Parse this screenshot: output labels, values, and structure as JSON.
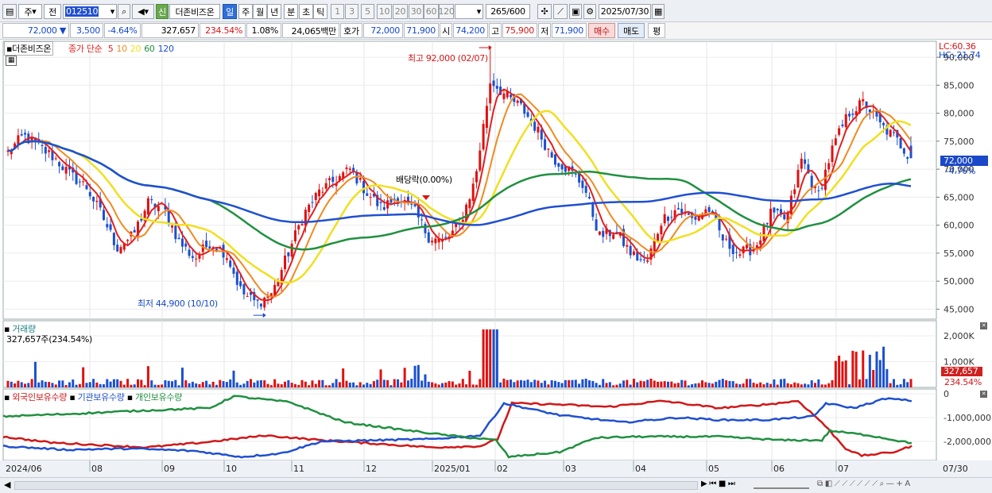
{
  "toolbar": {
    "period_stock": "주",
    "period_prev": "전",
    "code": "012510",
    "new_badge": "신",
    "stock_name": "더존비즈온",
    "periods": [
      "일",
      "주",
      "월",
      "년",
      "분",
      "초",
      "틱"
    ],
    "active_period": "일",
    "intervals": [
      "1",
      "3",
      "5",
      "10",
      "20",
      "30",
      "60",
      "120"
    ],
    "count": "265",
    "count_max": "/600",
    "date": "2025/07/30"
  },
  "quote": {
    "price": "72,000",
    "change_arrow": "▼",
    "change": "3,500",
    "change_pct": "-4.64%",
    "volume": "327,657",
    "volume_ratio": "234.54%",
    "turnover_rate": "1.08%",
    "trade_value": "24,065백만",
    "ask_label": "호가",
    "ask": "72,000",
    "bid": "71,900",
    "open_label": "시",
    "open": "74,200",
    "high_label": "고",
    "high": "75,900",
    "low_label": "저",
    "low": "71,900",
    "buy_button": "매수",
    "sell_button": "매도",
    "eval_button": "평"
  },
  "price_panel": {
    "title": "더존비즈온",
    "ma_label": "종가 단순",
    "ma_periods": [
      "5",
      "10",
      "20",
      "60",
      "120"
    ],
    "ma_colors": [
      "#e02020",
      "#f08a20",
      "#f0e020",
      "#209040",
      "#2050d0"
    ],
    "lc": "LC:60.36",
    "hc": "HC:-21.74",
    "high_note": "최고 92,000 (02/07)",
    "low_note": "최저 44,900 (10/10)",
    "dividend_note": "배당락(0.00%)",
    "current_price_tag": "72,000",
    "current_change_tag": "-4.76%",
    "y_ticks": [
      "90,000",
      "85,000",
      "80,000",
      "75,000",
      "70,000",
      "65,000",
      "60,000",
      "55,000",
      "50,000",
      "45,000"
    ]
  },
  "volume_panel": {
    "title": "거래량",
    "summary": "327,657주(234.54%)",
    "y_ticks": [
      "2,000K",
      "1,000K"
    ],
    "tag_value": "327,657",
    "tag_pct": "234.54%"
  },
  "holdings_panel": {
    "legend": [
      "외국인보유수량",
      "기관보유수량",
      "개인보유수량"
    ],
    "legend_colors": [
      "#d01818",
      "#2050d0",
      "#209040"
    ],
    "y_ticks": [
      "0",
      "-1,000,000",
      "-2,000,000"
    ]
  },
  "x_axis": [
    "2024/06",
    "08",
    "09",
    "10",
    "11",
    "12",
    "2025/01",
    "02",
    "03",
    "04",
    "05",
    "06",
    "07"
  ],
  "x_axis_right": "07/30",
  "chart_data": {
    "type": "candlestick",
    "title": "더존비즈온",
    "x_range": [
      "2024/06",
      "2025/07/30"
    ],
    "y_range": [
      43500,
      92000
    ],
    "highest": {
      "value": 92000,
      "date": "02/07"
    },
    "lowest": {
      "value": 44900,
      "date": "10/10"
    },
    "last": {
      "date": "2025/07/30",
      "open": 74200,
      "high": 75900,
      "low": 71900,
      "close": 72000,
      "volume": 327657
    },
    "close_path": [
      [
        "2024/06",
        73000
      ],
      [
        "2024/06",
        76000
      ],
      [
        "2024/07",
        74000
      ],
      [
        "2024/07",
        72000
      ],
      [
        "2024/07",
        69000
      ],
      [
        "2024/08",
        67000
      ],
      [
        "2024/08",
        62000
      ],
      [
        "2024/08",
        56000
      ],
      [
        "2024/08",
        58000
      ],
      [
        "2024/08",
        64000
      ],
      [
        "2024/09",
        63000
      ],
      [
        "2024/09",
        57000
      ],
      [
        "2024/09",
        54000
      ],
      [
        "2024/09",
        57000
      ],
      [
        "2024/10",
        55000
      ],
      [
        "2024/10",
        48000
      ],
      [
        "2024/10",
        46000
      ],
      [
        "2024/10",
        48000
      ],
      [
        "2024/11",
        55000
      ],
      [
        "2024/11",
        62000
      ],
      [
        "2024/11",
        66000
      ],
      [
        "2024/11",
        68000
      ],
      [
        "2024/12",
        70000
      ],
      [
        "2024/12",
        66000
      ],
      [
        "2024/12",
        63000
      ],
      [
        "2024/12",
        65000
      ],
      [
        "2025/01",
        63000
      ],
      [
        "2025/01",
        58000
      ],
      [
        "2025/01",
        57000
      ],
      [
        "2025/01",
        60000
      ],
      [
        "2025/01",
        68000
      ],
      [
        "2025/02",
        86000
      ],
      [
        "2025/02",
        83000
      ],
      [
        "2025/02",
        81000
      ],
      [
        "2025/03",
        77000
      ],
      [
        "2025/03",
        72000
      ],
      [
        "2025/03",
        70000
      ],
      [
        "2025/03",
        67000
      ],
      [
        "2025/04",
        58000
      ],
      [
        "2025/04",
        59000
      ],
      [
        "2025/04",
        55000
      ],
      [
        "2025/04",
        53000
      ],
      [
        "2025/04",
        61000
      ],
      [
        "2025/05",
        63000
      ],
      [
        "2025/05",
        61000
      ],
      [
        "2025/05",
        63000
      ],
      [
        "2025/05",
        57000
      ],
      [
        "2025/05",
        55000
      ],
      [
        "2025/06",
        56000
      ],
      [
        "2025/06",
        62000
      ],
      [
        "2025/06",
        61000
      ],
      [
        "2025/06",
        72000
      ],
      [
        "2025/07",
        65000
      ],
      [
        "2025/07",
        74000
      ],
      [
        "2025/07",
        80000
      ],
      [
        "2025/07",
        82000
      ],
      [
        "2025/07",
        78000
      ],
      [
        "2025/07",
        75500
      ],
      [
        "2025/07/30",
        72000
      ]
    ],
    "volume_spikes_k": [
      [
        "2024/10",
        1100
      ],
      [
        "2024/10",
        1200
      ],
      [
        "2025/01",
        1700
      ],
      [
        "2025/02",
        2250
      ],
      [
        "2025/03",
        1100
      ],
      [
        "2025/04",
        750
      ],
      [
        "2025/07",
        1550
      ],
      [
        "2025/07",
        1600
      ],
      [
        "2025/07",
        1500
      ],
      [
        "2025/07/30",
        328
      ]
    ],
    "holdings_series": [
      {
        "name": "외국인보유수량",
        "range": [
          -2600000,
          -250000
        ]
      },
      {
        "name": "기관보유수량",
        "range": [
          -2400000,
          -50000
        ]
      },
      {
        "name": "개인보유수량",
        "range": [
          -2650000,
          -50000
        ]
      }
    ]
  }
}
